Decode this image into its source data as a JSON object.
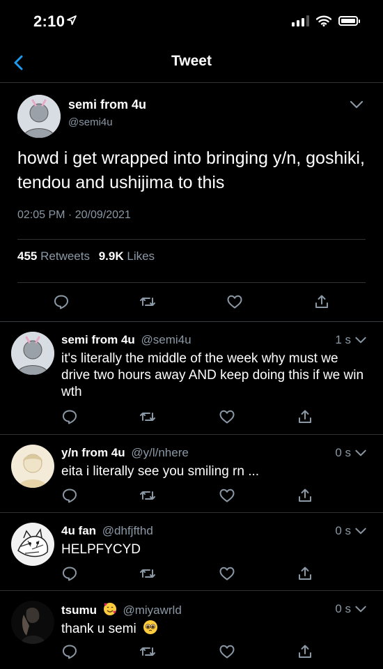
{
  "status": {
    "time": "2:10"
  },
  "nav": {
    "title": "Tweet"
  },
  "tweet": {
    "name": "semi from 4u",
    "handle": "@semi4u",
    "text": "howd i get wrapped into bringing y/n, goshiki, tendou and ushijima to this",
    "datetime": "02:05 PM · 20/09/2021",
    "retweets": "455",
    "retweets_label": "Retweets",
    "likes": "9.9K",
    "likes_label": "Likes"
  },
  "replies": [
    {
      "name": "semi from 4u",
      "handle": "@semi4u",
      "time": "1 s",
      "text": "it's literally the middle of the week why must we drive two hours away AND keep doing this if we win wth",
      "avatar": "gray"
    },
    {
      "name": "y/n from 4u",
      "handle": "@y/l/nhere",
      "time": "0 s",
      "text": "eita i literally see you smiling rn ...",
      "avatar": "beige"
    },
    {
      "name": "4u fan",
      "handle": "@dhfjfthd",
      "time": "0 s",
      "text": "HELPFYCYD",
      "avatar": "sketch"
    },
    {
      "name": "tsumu",
      "handle": "@miyawrld",
      "time": "0 s",
      "text": "thank u semi",
      "avatar": "dark"
    }
  ],
  "icons": [
    "back-chevron-icon",
    "chevron-down-icon",
    "reply-icon",
    "retweet-icon",
    "like-icon",
    "share-icon",
    "signal-icon",
    "wifi-icon",
    "battery-icon",
    "location-arrow-icon"
  ],
  "colors": {
    "accent": "#1d9bf0",
    "muted": "#8b98a5",
    "divider": "#2f3336"
  }
}
